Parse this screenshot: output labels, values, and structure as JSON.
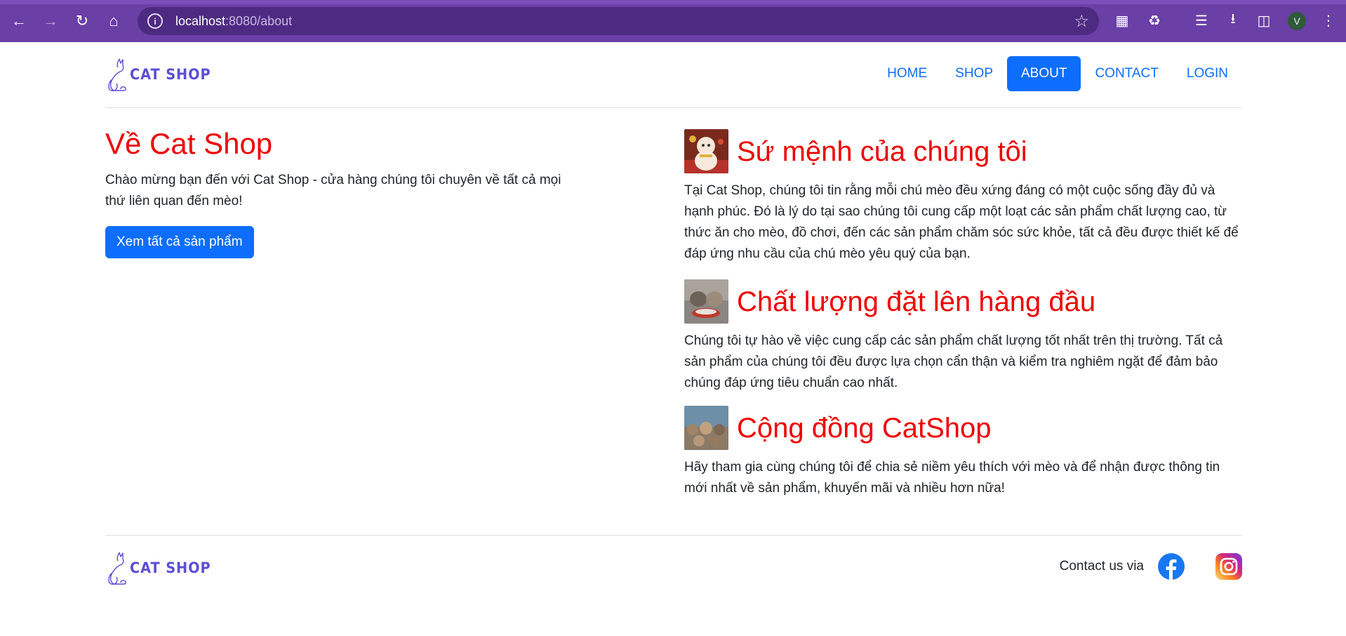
{
  "browser": {
    "url_host": "localhost",
    "url_rest": ":8080/about",
    "profile_initial": "V"
  },
  "brand": {
    "logo_text": "CAT SHOP"
  },
  "nav": {
    "items": [
      {
        "label": "HOME",
        "active": false
      },
      {
        "label": "SHOP",
        "active": false
      },
      {
        "label": "ABOUT",
        "active": true
      },
      {
        "label": "CONTACT",
        "active": false
      },
      {
        "label": "LOGIN",
        "active": false
      }
    ]
  },
  "intro": {
    "title": "Về Cat Shop",
    "text": "Chào mừng bạn đến với Cat Shop - cửa hàng chúng tôi chuyên về tất cả mọi thứ liên quan đến mèo!",
    "button": "Xem tất cả sản phẩm"
  },
  "sections": [
    {
      "title": "Sứ mệnh của chúng tôi",
      "text": "Tại Cat Shop, chúng tôi tin rằng mỗi chú mèo đều xứng đáng có một cuộc sống đầy đủ và hạnh phúc. Đó là lý do tại sao chúng tôi cung cấp một loạt các sản phẩm chất lượng cao, từ thức ăn cho mèo, đồ chơi, đến các sản phẩm chăm sóc sức khỏe, tất cả đều được thiết kế để đáp ứng nhu cầu của chú mèo yêu quý của bạn."
    },
    {
      "title": "Chất lượng đặt lên hàng đầu",
      "text": "Chúng tôi tự hào về việc cung cấp các sản phẩm chất lượng tốt nhất trên thị trường. Tất cả sản phẩm của chúng tôi đều được lựa chọn cẩn thận và kiểm tra nghiêm ngặt để đảm bảo chúng đáp ứng tiêu chuẩn cao nhất."
    },
    {
      "title": "Cộng đồng CatShop",
      "text": "Hãy tham gia cùng chúng tôi để chia sẻ niềm yêu thích với mèo và để nhận được thông tin mới nhất về sản phẩm, khuyến mãi và nhiều hơn nữa!"
    }
  ],
  "footer": {
    "contact_text": "Contact us via"
  },
  "colors": {
    "accent": "#0d6efd",
    "heading_red": "#ee0000",
    "browser_purple": "#6a3fa6"
  }
}
